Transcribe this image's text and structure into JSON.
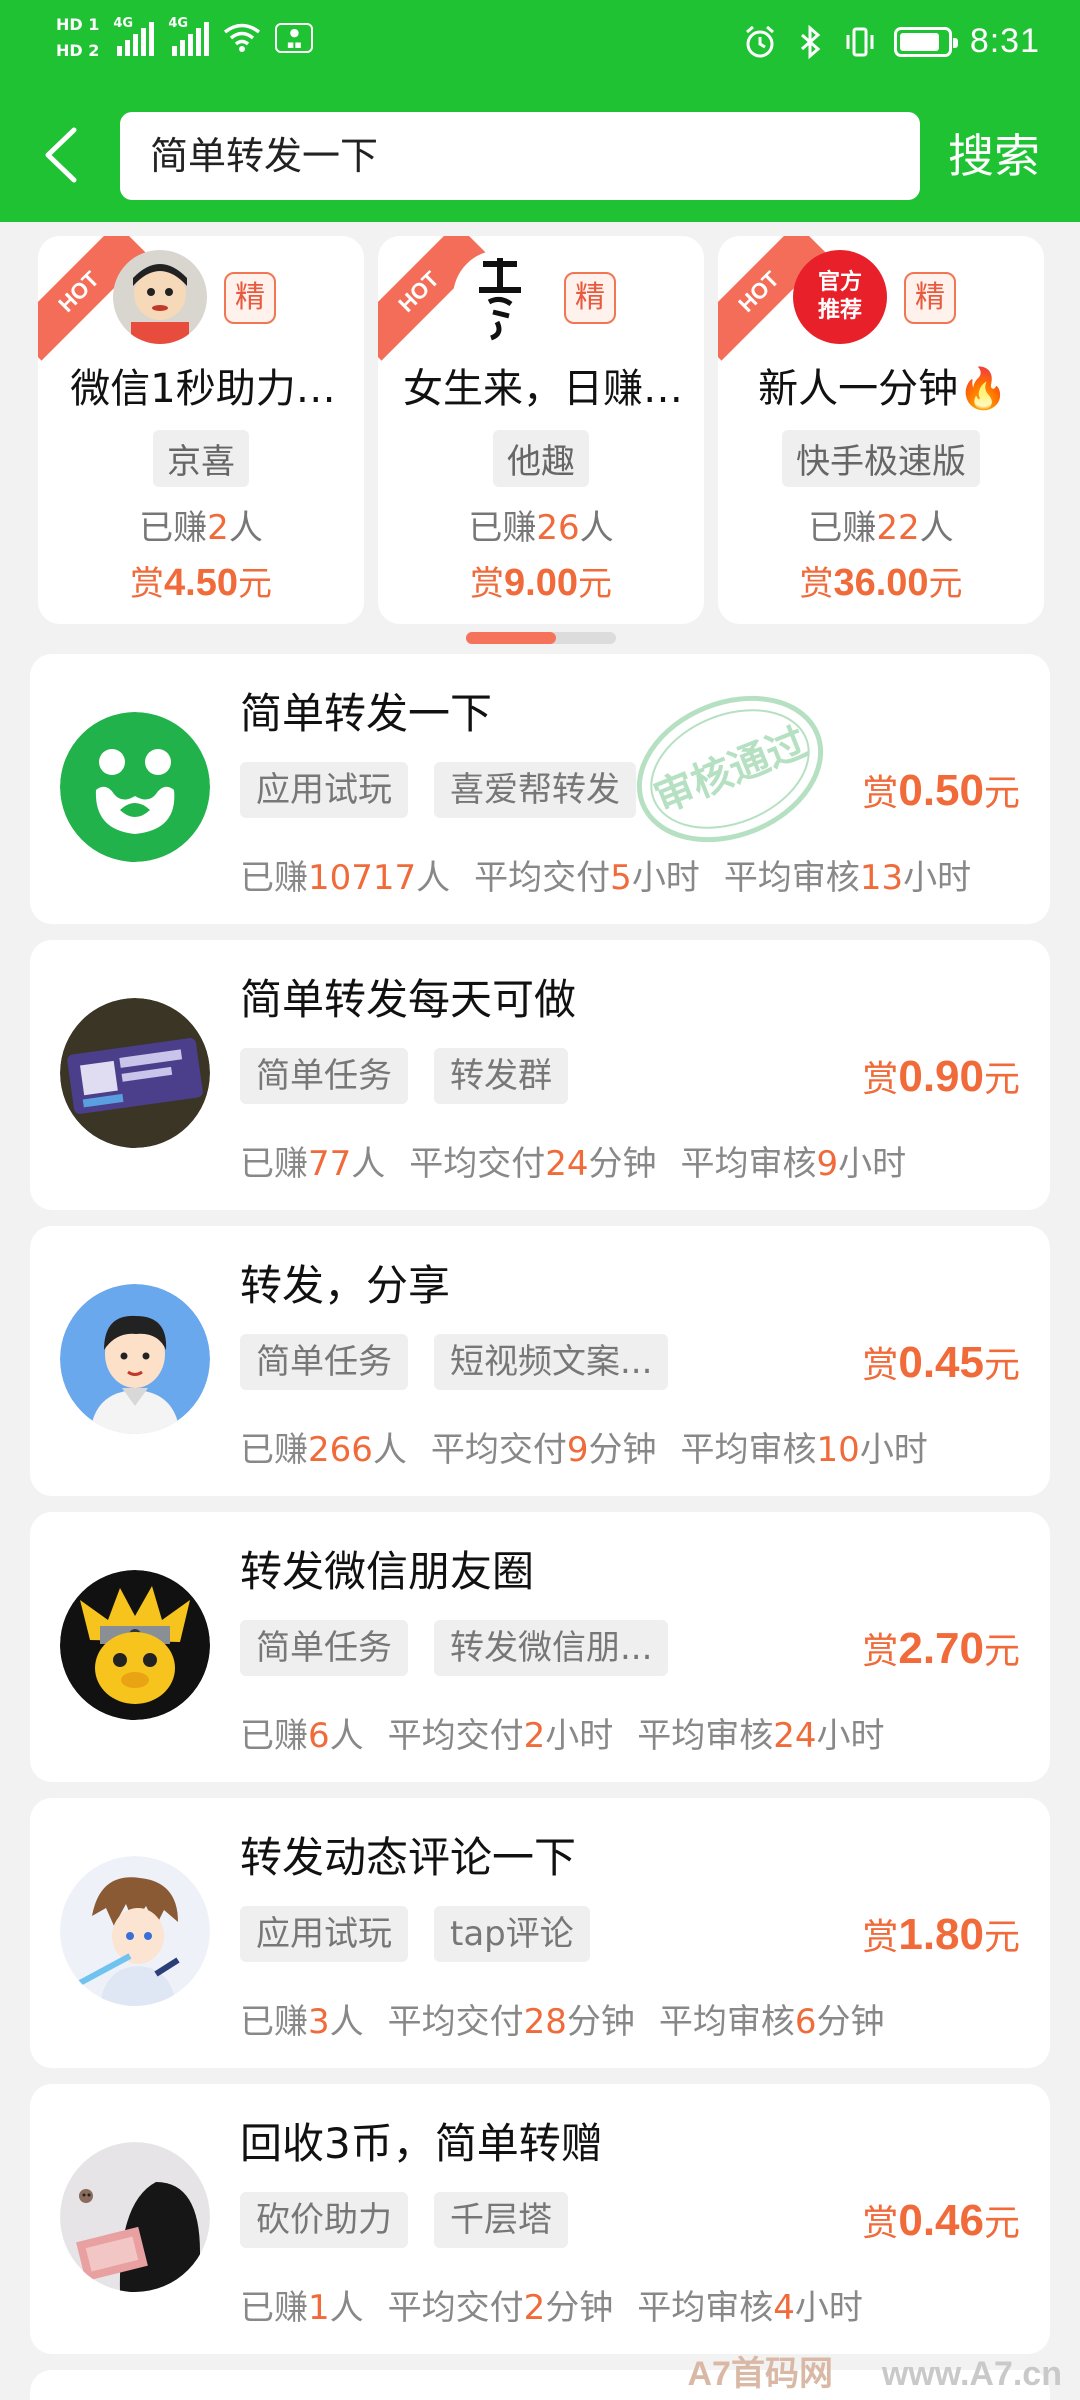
{
  "status_bar": {
    "hd1": "HD 1",
    "hd2": "HD 2",
    "net1": "4G",
    "net2": "4G",
    "battery_level": 0.85,
    "time": "8:31"
  },
  "header": {
    "search_value": "简单转发一下",
    "search_button": "搜索",
    "bg_color": "#1fc233"
  },
  "hot_cards": [
    {
      "ribbon": "HOT",
      "badge": "精",
      "title": "微信1秒助力…",
      "tag": "京喜",
      "earned_prefix": "已赚",
      "earned_num": "2",
      "earned_suffix": "人",
      "reward_prefix": "赏",
      "reward_amount": "4.50",
      "reward_suffix": "元"
    },
    {
      "ribbon": "HOT",
      "badge": "精",
      "title": "女生来，日赚…",
      "tag": "他趣",
      "earned_prefix": "已赚",
      "earned_num": "26",
      "earned_suffix": "人",
      "reward_prefix": "赏",
      "reward_amount": "9.00",
      "reward_suffix": "元"
    },
    {
      "ribbon": "HOT",
      "badge": "精",
      "avatar_text": "官方推荐",
      "title": "新人一分钟🔥",
      "tag": "快手极速版",
      "earned_prefix": "已赚",
      "earned_num": "22",
      "earned_suffix": "人",
      "reward_prefix": "赏",
      "reward_amount": "36.00",
      "reward_suffix": "元"
    }
  ],
  "carousel": {
    "active_page": 1,
    "page_count": 2
  },
  "tasks": [
    {
      "title": "简单转发一下",
      "tags": [
        "应用试玩",
        "喜爱帮转发"
      ],
      "reward_prefix": "赏",
      "reward_amount": "0.50",
      "reward_suffix": "元",
      "earned_label": "已赚",
      "earned_num": "10717",
      "earned_unit": "人",
      "delivery_label": "平均交付",
      "delivery_num": "5",
      "delivery_unit": "小时",
      "review_label": "平均审核",
      "review_num": "13",
      "review_unit": "小时",
      "stamp_text": "审核通过"
    },
    {
      "title": "简单转发每天可做",
      "tags": [
        "简单任务",
        "转发群"
      ],
      "reward_prefix": "赏",
      "reward_amount": "0.90",
      "reward_suffix": "元",
      "earned_label": "已赚",
      "earned_num": "77",
      "earned_unit": "人",
      "delivery_label": "平均交付",
      "delivery_num": "24",
      "delivery_unit": "分钟",
      "review_label": "平均审核",
      "review_num": "9",
      "review_unit": "小时"
    },
    {
      "title": "转发，分享",
      "tags": [
        "简单任务",
        "短视频文案..."
      ],
      "reward_prefix": "赏",
      "reward_amount": "0.45",
      "reward_suffix": "元",
      "earned_label": "已赚",
      "earned_num": "266",
      "earned_unit": "人",
      "delivery_label": "平均交付",
      "delivery_num": "9",
      "delivery_unit": "分钟",
      "review_label": "平均审核",
      "review_num": "10",
      "review_unit": "小时"
    },
    {
      "title": "转发微信朋友圈",
      "tags": [
        "简单任务",
        "转发微信朋..."
      ],
      "reward_prefix": "赏",
      "reward_amount": "2.70",
      "reward_suffix": "元",
      "earned_label": "已赚",
      "earned_num": "6",
      "earned_unit": "人",
      "delivery_label": "平均交付",
      "delivery_num": "2",
      "delivery_unit": "小时",
      "review_label": "平均审核",
      "review_num": "24",
      "review_unit": "小时"
    },
    {
      "title": "转发动态评论一下",
      "tags": [
        "应用试玩",
        "tap评论"
      ],
      "reward_prefix": "赏",
      "reward_amount": "1.80",
      "reward_suffix": "元",
      "earned_label": "已赚",
      "earned_num": "3",
      "earned_unit": "人",
      "delivery_label": "平均交付",
      "delivery_num": "28",
      "delivery_unit": "分钟",
      "review_label": "平均审核",
      "review_num": "6",
      "review_unit": "分钟"
    },
    {
      "title": "回收3币，简单转赠",
      "tags": [
        "砍价助力",
        "千层塔"
      ],
      "reward_prefix": "赏",
      "reward_amount": "0.46",
      "reward_suffix": "元",
      "earned_label": "已赚",
      "earned_num": "1",
      "earned_unit": "人",
      "delivery_label": "平均交付",
      "delivery_num": "2",
      "delivery_unit": "分钟",
      "review_label": "平均审核",
      "review_num": "4",
      "review_unit": "小时"
    }
  ],
  "watermark": {
    "brand": "A7首码网",
    "url": "www.A7.cn"
  },
  "colors": {
    "accent_green": "#1fc233",
    "reward_orange": "#f06a3a",
    "hot_red": "#f46d58"
  }
}
